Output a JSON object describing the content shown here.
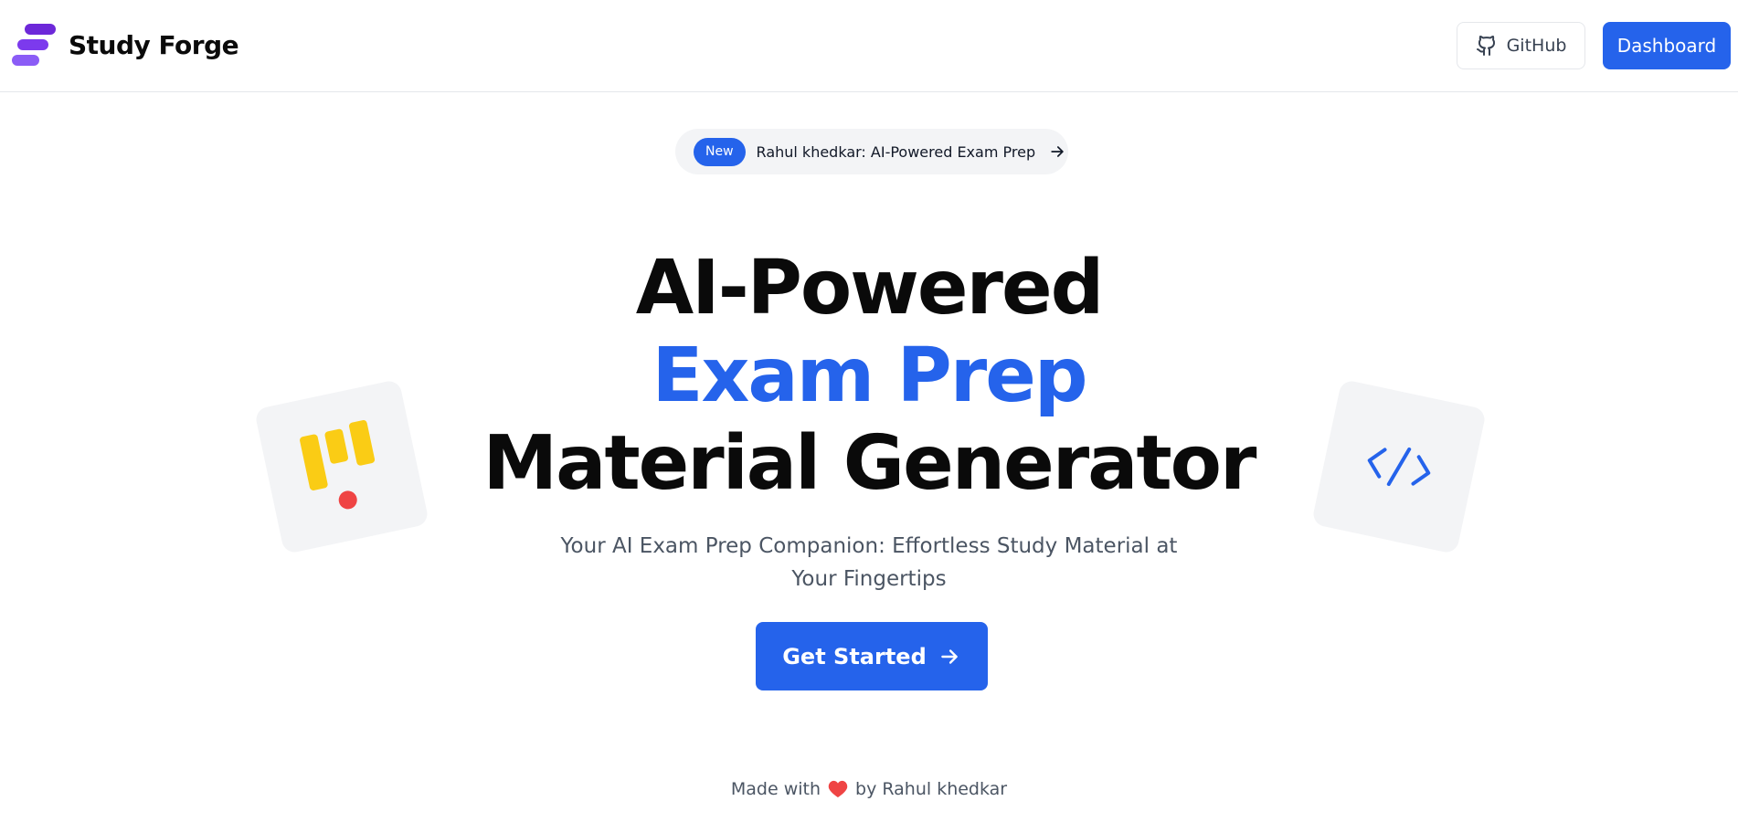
{
  "header": {
    "brand_name": "Study Forge",
    "github_label": "GitHub",
    "dashboard_label": "Dashboard"
  },
  "announcement": {
    "badge": "New",
    "text": "Rahul khedkar: AI-Powered Exam Prep"
  },
  "hero": {
    "title_line1": "AI-Powered",
    "title_line2": "Exam Prep",
    "title_line3": "Material Generator",
    "subtitle": "Your AI Exam Prep Companion: Effortless Study Material at Your Fingertips",
    "cta_label": "Get Started"
  },
  "footer": {
    "made_with": "Made with",
    "by_text": "by Rahul khedkar"
  },
  "icons": {
    "brand": "study-forge-logo-icon",
    "github": "github-icon",
    "pill_arrow": "arrow-right-icon",
    "cta_arrow": "arrow-right-icon",
    "left_card": "kanban-icon",
    "right_card": "code-icon",
    "footer": "heart-icon"
  },
  "colors": {
    "accent": "#2563eb",
    "brand_logo": "#6d28d9",
    "card_bg": "#f3f4f6",
    "kanban_yellow": "#facc15",
    "dot_red": "#ef4444",
    "heart_red": "#ef4444"
  }
}
